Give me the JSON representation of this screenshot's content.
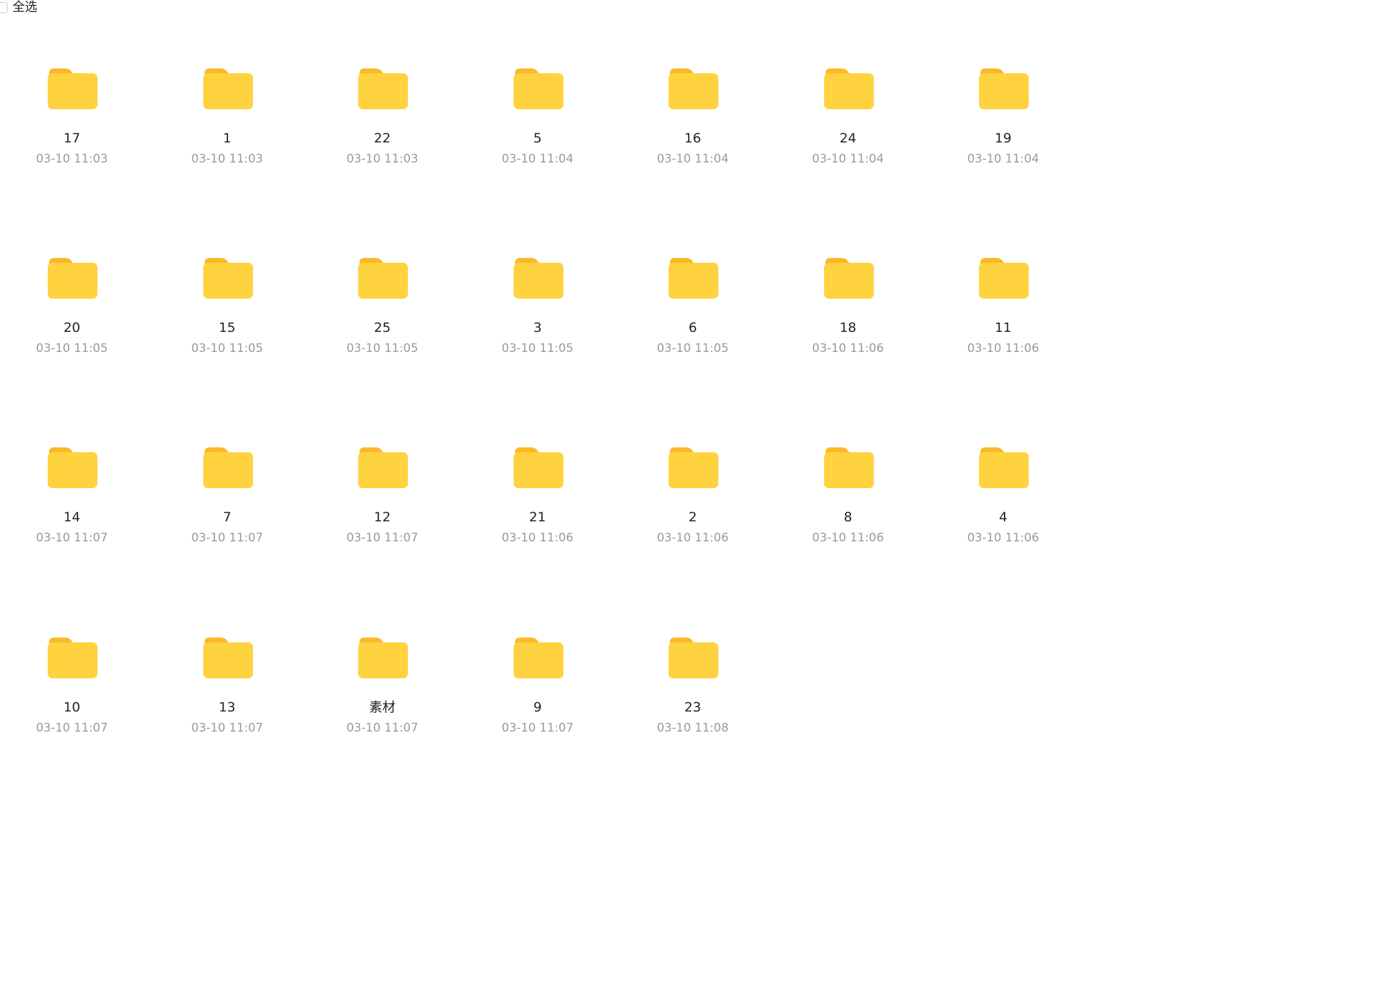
{
  "toolbar": {
    "select_all_label": "全选"
  },
  "colors": {
    "folder_front": "#FFD23F",
    "folder_back": "#FBB82A"
  },
  "folders": [
    {
      "name": "17",
      "date": "03-10 11:03"
    },
    {
      "name": "1",
      "date": "03-10 11:03"
    },
    {
      "name": "22",
      "date": "03-10 11:03"
    },
    {
      "name": "5",
      "date": "03-10 11:04"
    },
    {
      "name": "16",
      "date": "03-10 11:04"
    },
    {
      "name": "24",
      "date": "03-10 11:04"
    },
    {
      "name": "19",
      "date": "03-10 11:04"
    },
    {
      "name": "20",
      "date": "03-10 11:05"
    },
    {
      "name": "15",
      "date": "03-10 11:05"
    },
    {
      "name": "25",
      "date": "03-10 11:05"
    },
    {
      "name": "3",
      "date": "03-10 11:05"
    },
    {
      "name": "6",
      "date": "03-10 11:05"
    },
    {
      "name": "18",
      "date": "03-10 11:06"
    },
    {
      "name": "11",
      "date": "03-10 11:06"
    },
    {
      "name": "14",
      "date": "03-10 11:07"
    },
    {
      "name": "7",
      "date": "03-10 11:07"
    },
    {
      "name": "12",
      "date": "03-10 11:07"
    },
    {
      "name": "21",
      "date": "03-10 11:06"
    },
    {
      "name": "2",
      "date": "03-10 11:06"
    },
    {
      "name": "8",
      "date": "03-10 11:06"
    },
    {
      "name": "4",
      "date": "03-10 11:06"
    },
    {
      "name": "10",
      "date": "03-10 11:07"
    },
    {
      "name": "13",
      "date": "03-10 11:07"
    },
    {
      "name": "素材",
      "date": "03-10 11:07"
    },
    {
      "name": "9",
      "date": "03-10 11:07"
    },
    {
      "name": "23",
      "date": "03-10 11:08"
    }
  ]
}
